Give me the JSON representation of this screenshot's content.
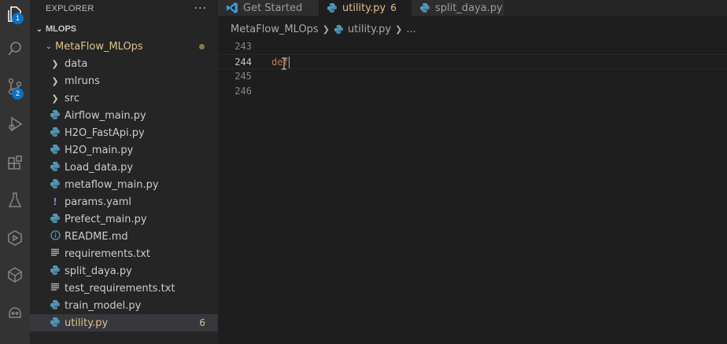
{
  "explorer": {
    "title": "EXPLORER",
    "more": "···",
    "section": "MLOPS",
    "project": "MetaFlow_MLOps"
  },
  "activity_bar": {
    "explorer_badge": "1",
    "source_control_badge": "2"
  },
  "files": [
    {
      "label": "data",
      "kind": "folder"
    },
    {
      "label": "mlruns",
      "kind": "folder"
    },
    {
      "label": "src",
      "kind": "folder"
    },
    {
      "label": "Airflow_main.py",
      "kind": "python"
    },
    {
      "label": "H2O_FastApi.py",
      "kind": "python"
    },
    {
      "label": "H2O_main.py",
      "kind": "python"
    },
    {
      "label": "Load_data.py",
      "kind": "python"
    },
    {
      "label": "metaflow_main.py",
      "kind": "python"
    },
    {
      "label": "params.yaml",
      "kind": "yaml"
    },
    {
      "label": "Prefect_main.py",
      "kind": "python"
    },
    {
      "label": "README.md",
      "kind": "info"
    },
    {
      "label": "requirements.txt",
      "kind": "text"
    },
    {
      "label": "split_daya.py",
      "kind": "python"
    },
    {
      "label": "test_requirements.txt",
      "kind": "text"
    },
    {
      "label": "train_model.py",
      "kind": "python"
    },
    {
      "label": "utility.py",
      "kind": "python",
      "problems": "6",
      "selected": true
    }
  ],
  "tabs": [
    {
      "label": "Get Started"
    },
    {
      "label": "utility.py",
      "problems": "6"
    },
    {
      "label": "split_daya.py"
    }
  ],
  "breadcrumb": [
    "MetaFlow_MLOps",
    "utility.py",
    "..."
  ],
  "editor": {
    "lines": [
      {
        "number": "243",
        "text": ""
      },
      {
        "number": "244",
        "text": "def"
      },
      {
        "number": "245",
        "text": ""
      },
      {
        "number": "246",
        "text": ""
      }
    ]
  },
  "colors": {
    "python_icon": "#519aba",
    "modified": "#e2c08d",
    "badge": "#0e70c0",
    "keyword": "#cc7359",
    "yaml_icon": "#a074c4"
  }
}
